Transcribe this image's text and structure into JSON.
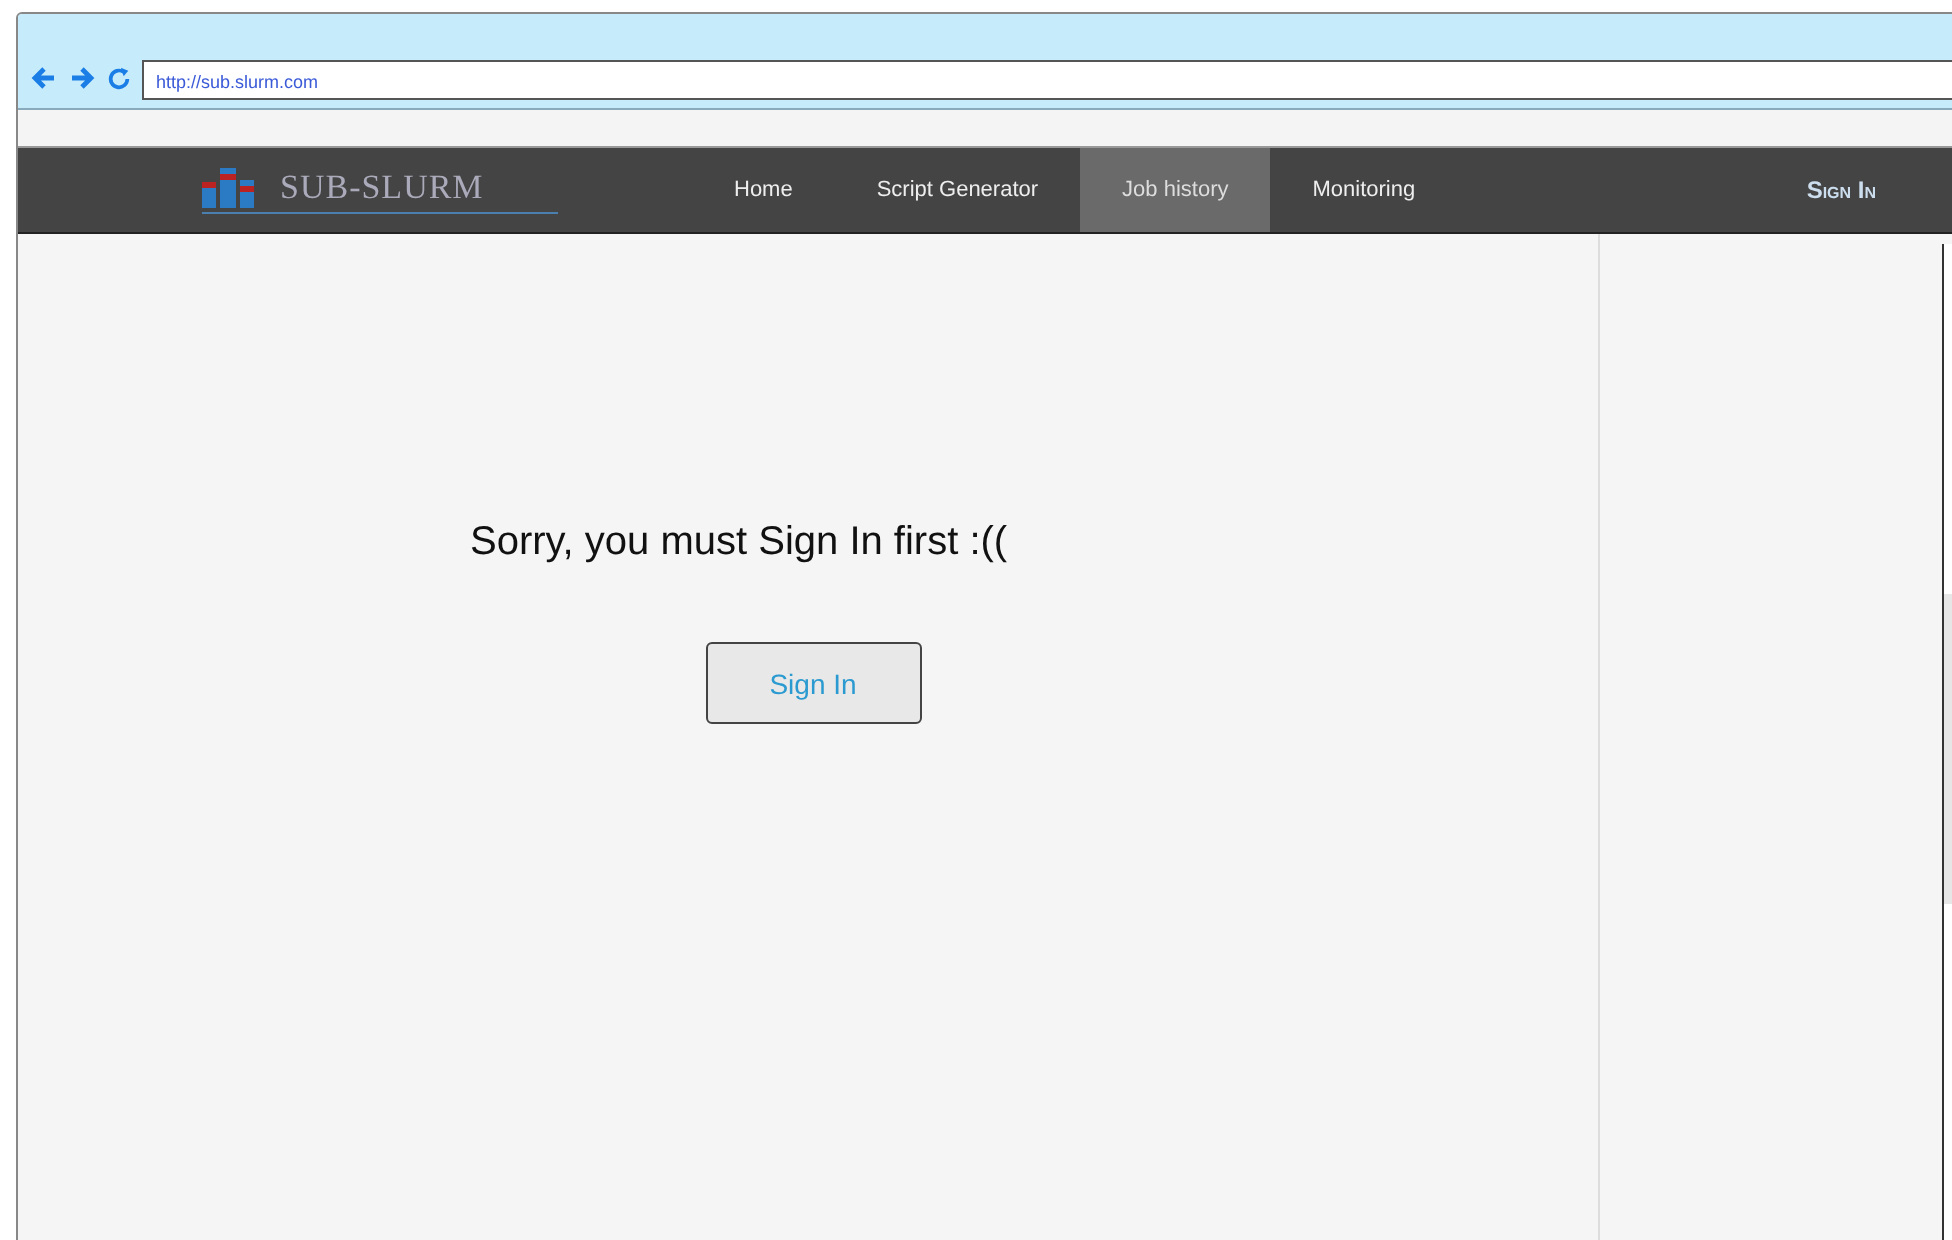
{
  "browser": {
    "url": "http://sub.slurm.com"
  },
  "logo": {
    "text": "SUB-SLURM"
  },
  "nav": [
    {
      "label": "Home",
      "selected": false
    },
    {
      "label": "Script Generator",
      "selected": false
    },
    {
      "label": "Job history",
      "selected": true
    },
    {
      "label": "Monitoring",
      "selected": false
    }
  ],
  "sign_in_link": "Sign In",
  "message": "Sorry, you must Sign In first :((",
  "sign_in_button": "Sign In"
}
